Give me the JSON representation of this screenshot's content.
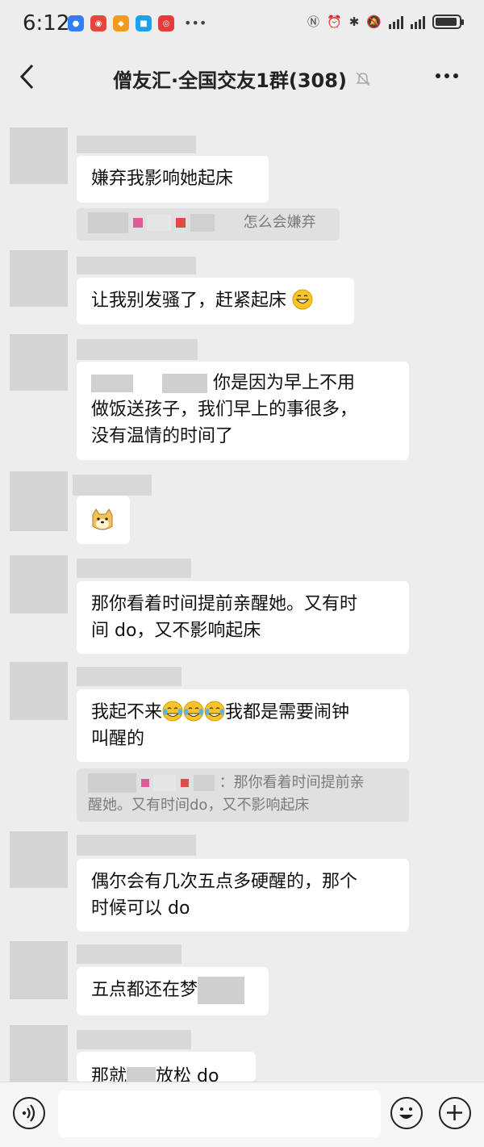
{
  "status_bar": {
    "time": "6:12",
    "icons": [
      "app-icon-1",
      "weibo-icon",
      "app-icon-3",
      "app-icon-4",
      "app-icon-5",
      "more-dots-icon"
    ],
    "right_icons": [
      "nfc-icon",
      "alarm-icon",
      "bluetooth-icon",
      "mute-icon",
      "signal-icon",
      "signal-icon",
      "battery-icon"
    ]
  },
  "header": {
    "title": "僧友汇·全国交友1群(308)",
    "back_icon": "chevron-left-icon",
    "mute_icon": "bell-off-icon",
    "more_icon": "more-horizontal-icon"
  },
  "messages": [
    {
      "text": "嫌弃我影响她起床"
    },
    {
      "quote": "怎么会嫌弃"
    },
    {
      "text": "让我别发骚了，赶紧起床",
      "emoji": "grinning-emoji"
    },
    {
      "text_line1": "你是因为早上不用",
      "text_line2": "做饭送孩子，我们早上的事很多，",
      "text_line3": "没有温情的时间了"
    },
    {
      "sticker": "doge-emoji"
    },
    {
      "text_line1": "那你看着时间提前亲醒她。又有时",
      "text_line2": "间 do，又不影响起床"
    },
    {
      "text_part1": "我起不来",
      "text_part2": "我都是需要闹钟",
      "text_line2": "叫醒的",
      "emoji": "tears-of-joy-emoji"
    },
    {
      "quote_line1": "：那你看着时间提前亲",
      "quote_line2": "醒她。又有时间do，又不影响起床"
    },
    {
      "text_line1": "偶尔会有几次五点多硬醒的，那个",
      "text_line2": "时候可以 do"
    },
    {
      "text": "五点都还在梦"
    },
    {
      "text": "那就",
      "text_tail": "放松 do"
    }
  ],
  "input_bar": {
    "voice_icon": "voice-icon",
    "emoji_icon": "smile-icon",
    "plus_icon": "plus-icon"
  }
}
